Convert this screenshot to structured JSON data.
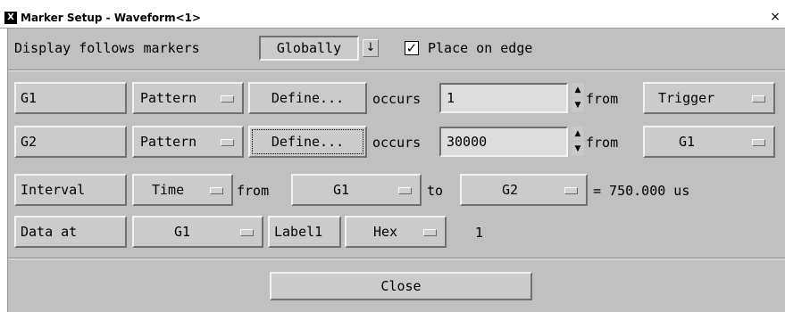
{
  "window": {
    "title": "Marker Setup - Waveform<1>",
    "logo": "X",
    "close_glyph": "×"
  },
  "display": {
    "label": "Display follows markers",
    "mode": "Globally",
    "dropdown_glyph": "↓",
    "place_on_edge_label": "Place on edge",
    "place_on_edge_checked": true,
    "check_glyph": "✓"
  },
  "markers": [
    {
      "name": "G1",
      "type": "Pattern",
      "define": "Define...",
      "occurs_label": "occurs",
      "occurs": "1",
      "from_label": "from",
      "from": "Trigger"
    },
    {
      "name": "G2",
      "type": "Pattern",
      "define": "Define...",
      "occurs_label": "occurs",
      "occurs": "30000",
      "from_label": "from",
      "from": "G1"
    }
  ],
  "interval": {
    "label": "Interval",
    "type": "Time",
    "from_label": "from",
    "from": "G1",
    "to_label": "to",
    "to": "G2",
    "result": "= 750.000 us"
  },
  "data_at": {
    "label": "Data at",
    "marker": "G1",
    "label_name": "Label1",
    "base": "Hex",
    "value": "1"
  },
  "spin_glyphs": {
    "up": "▲",
    "down": "▼"
  },
  "close_button": "Close"
}
